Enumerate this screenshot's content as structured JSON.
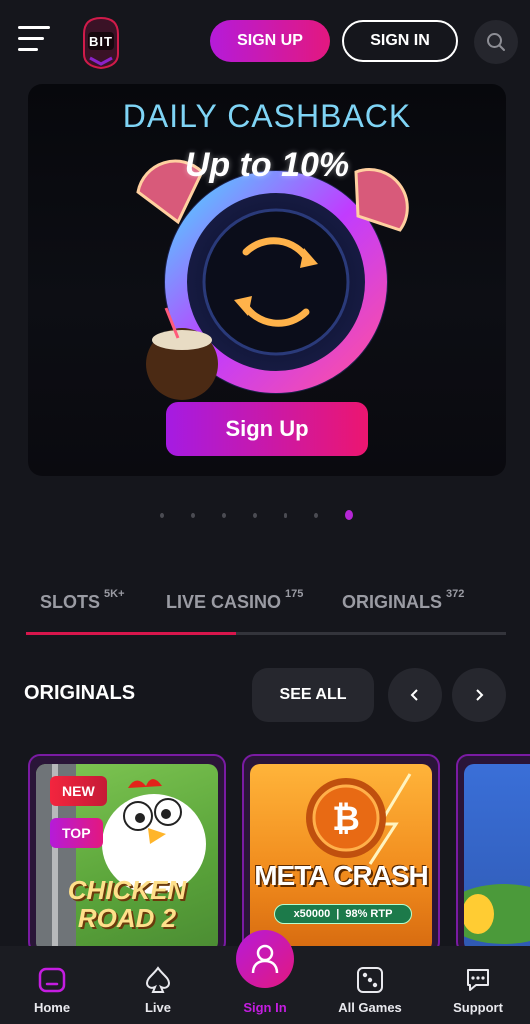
{
  "header": {
    "logo_text": "BIT",
    "signup_label": "SIGN UP",
    "signin_label": "SIGN IN"
  },
  "banner": {
    "title": "DAILY CASHBACK",
    "subtitle": "Up to 10%",
    "button_label": "Sign Up",
    "slides_total": 7,
    "slide_active": 7
  },
  "tabs": [
    {
      "label": "SLOTS",
      "count": "5K+"
    },
    {
      "label": "LIVE CASINO",
      "count": "175"
    },
    {
      "label": "ORIGINALS",
      "count": "372"
    }
  ],
  "section": {
    "title": "ORIGINALS",
    "see_all_label": "SEE ALL"
  },
  "games": [
    {
      "name_line1": "CHICKEN",
      "name_line2": "ROAD 2",
      "badges": [
        "NEW",
        "TOP"
      ]
    },
    {
      "name": "META CRASH",
      "multiplier": "x50000",
      "rtp": "98% RTP"
    }
  ],
  "bottom_nav": {
    "items": [
      {
        "label": "Home"
      },
      {
        "label": "Live"
      },
      {
        "label": "Sign In"
      },
      {
        "label": "All Games"
      },
      {
        "label": "Support"
      }
    ]
  },
  "colors": {
    "background": "#15161c",
    "accent_purple": "#b51bd9",
    "accent_pink": "#e3187f",
    "tab_underline": "#d7164c"
  }
}
